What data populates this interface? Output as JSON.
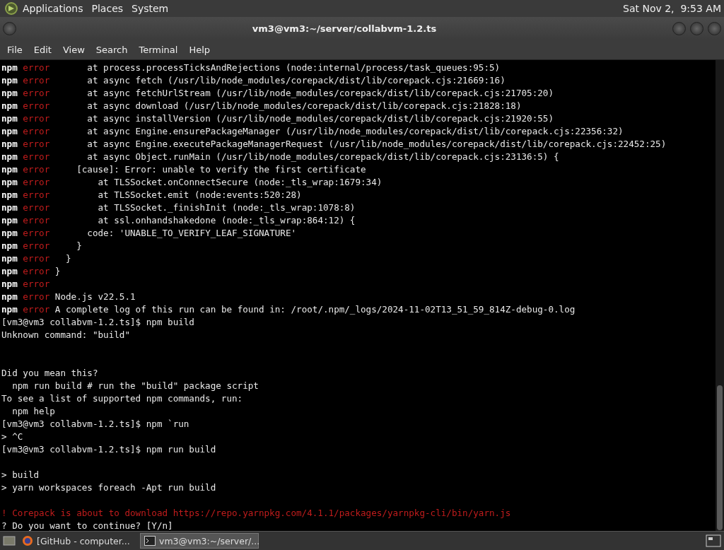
{
  "top_panel": {
    "menus": [
      "Applications",
      "Places",
      "System"
    ],
    "clock": "Sat Nov 2,  9:53 AM"
  },
  "window": {
    "title": "vm3@vm3:~/server/collabvm-1.2.ts"
  },
  "menu_bar": [
    "File",
    "Edit",
    "View",
    "Search",
    "Terminal",
    "Help"
  ],
  "terminal_lines": [
    {
      "kind": "npm_error",
      "prefix": "npm",
      "tag": "error",
      "text": "      at process.processTicksAndRejections (node:internal/process/task_queues:95:5)"
    },
    {
      "kind": "npm_error",
      "prefix": "npm",
      "tag": "error",
      "text": "      at async fetch (/usr/lib/node_modules/corepack/dist/lib/corepack.cjs:21669:16)"
    },
    {
      "kind": "npm_error",
      "prefix": "npm",
      "tag": "error",
      "text": "      at async fetchUrlStream (/usr/lib/node_modules/corepack/dist/lib/corepack.cjs:21705:20)"
    },
    {
      "kind": "npm_error",
      "prefix": "npm",
      "tag": "error",
      "text": "      at async download (/usr/lib/node_modules/corepack/dist/lib/corepack.cjs:21828:18)"
    },
    {
      "kind": "npm_error",
      "prefix": "npm",
      "tag": "error",
      "text": "      at async installVersion (/usr/lib/node_modules/corepack/dist/lib/corepack.cjs:21920:55)"
    },
    {
      "kind": "npm_error",
      "prefix": "npm",
      "tag": "error",
      "text": "      at async Engine.ensurePackageManager (/usr/lib/node_modules/corepack/dist/lib/corepack.cjs:22356:32)"
    },
    {
      "kind": "npm_error",
      "prefix": "npm",
      "tag": "error",
      "text": "      at async Engine.executePackageManagerRequest (/usr/lib/node_modules/corepack/dist/lib/corepack.cjs:22452:25)"
    },
    {
      "kind": "npm_error",
      "prefix": "npm",
      "tag": "error",
      "text": "      at async Object.runMain (/usr/lib/node_modules/corepack/dist/lib/corepack.cjs:23136:5) {"
    },
    {
      "kind": "npm_error",
      "prefix": "npm",
      "tag": "error",
      "text": "    [cause]: Error: unable to verify the first certificate"
    },
    {
      "kind": "npm_error",
      "prefix": "npm",
      "tag": "error",
      "text": "        at TLSSocket.onConnectSecure (node:_tls_wrap:1679:34)"
    },
    {
      "kind": "npm_error",
      "prefix": "npm",
      "tag": "error",
      "text": "        at TLSSocket.emit (node:events:520:28)"
    },
    {
      "kind": "npm_error",
      "prefix": "npm",
      "tag": "error",
      "text": "        at TLSSocket._finishInit (node:_tls_wrap:1078:8)"
    },
    {
      "kind": "npm_error",
      "prefix": "npm",
      "tag": "error",
      "text": "        at ssl.onhandshakedone (node:_tls_wrap:864:12) {"
    },
    {
      "kind": "npm_error",
      "prefix": "npm",
      "tag": "error",
      "text": "      code: 'UNABLE_TO_VERIFY_LEAF_SIGNATURE'"
    },
    {
      "kind": "npm_error",
      "prefix": "npm",
      "tag": "error",
      "text": "    }"
    },
    {
      "kind": "npm_error",
      "prefix": "npm",
      "tag": "error",
      "text": "  }"
    },
    {
      "kind": "npm_error",
      "prefix": "npm",
      "tag": "error",
      "text": "}"
    },
    {
      "kind": "npm_error",
      "prefix": "npm",
      "tag": "error"
    },
    {
      "kind": "npm_error",
      "prefix": "npm",
      "tag": "error",
      "text": "Node.js v22.5.1"
    },
    {
      "kind": "npm_error",
      "prefix": "npm",
      "tag": "error",
      "text": "A complete log of this run can be found in: /root/.npm/_logs/2024-11-02T13_51_59_814Z-debug-0.log"
    },
    {
      "kind": "plain",
      "text": "[vm3@vm3 collabvm-1.2.ts]$ npm build"
    },
    {
      "kind": "plain",
      "text": "Unknown command: \"build\""
    },
    {
      "kind": "blank"
    },
    {
      "kind": "blank"
    },
    {
      "kind": "plain",
      "text": "Did you mean this?"
    },
    {
      "kind": "plain",
      "text": "  npm run build # run the \"build\" package script"
    },
    {
      "kind": "plain",
      "text": "To see a list of supported npm commands, run:"
    },
    {
      "kind": "plain",
      "text": "  npm help"
    },
    {
      "kind": "plain",
      "text": "[vm3@vm3 collabvm-1.2.ts]$ npm `run"
    },
    {
      "kind": "plain",
      "text": "> ^C"
    },
    {
      "kind": "plain",
      "text": "[vm3@vm3 collabvm-1.2.ts]$ npm run build"
    },
    {
      "kind": "blank"
    },
    {
      "kind": "plain",
      "text": "> build"
    },
    {
      "kind": "plain",
      "text": "> yarn workspaces foreach -Apt run build"
    },
    {
      "kind": "blank"
    },
    {
      "kind": "warning",
      "text": "! Corepack is about to download https://repo.yarnpkg.com/4.1.1/packages/yarnpkg-cli/bin/yarn.js"
    },
    {
      "kind": "plain",
      "text": "? Do you want to continue? [Y/n]"
    }
  ],
  "taskbar": [
    {
      "label": "[GitHub - computer...",
      "kind": "browser",
      "selected": false
    },
    {
      "label": "vm3@vm3:~/server/...",
      "kind": "terminal",
      "selected": true
    }
  ]
}
